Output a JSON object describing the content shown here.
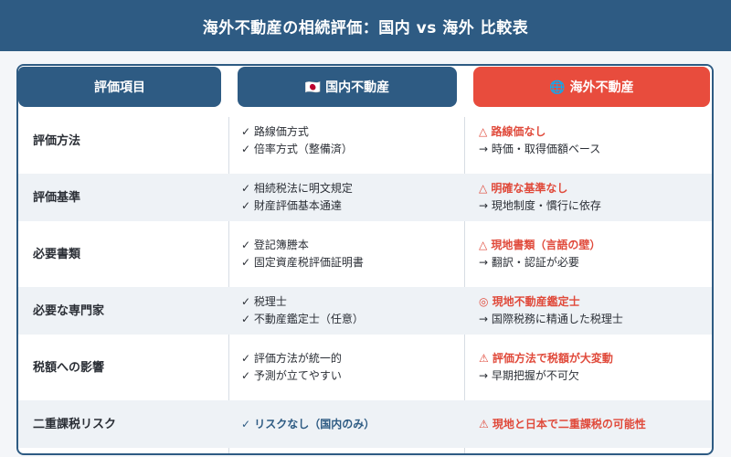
{
  "title": "海外不動産の相続評価：国内 vs 海外 比較表",
  "headers": {
    "item": "評価項目",
    "domestic": "🇯🇵 国内不動産",
    "overseas": "🌐 海外不動産"
  },
  "rows": [
    {
      "label": "評価方法",
      "domestic": [
        "✓ 路線価方式",
        "✓ 倍率方式（整備済）"
      ],
      "overseas_main": "△ 路線価なし",
      "overseas_sub": "→ 時価・取得価額ベース"
    },
    {
      "label": "評価基準",
      "domestic": [
        "✓ 相続税法に明文規定",
        "✓ 財産評価基本通達"
      ],
      "overseas_main": "△ 明確な基準なし",
      "overseas_sub": "→ 現地制度・慣行に依存"
    },
    {
      "label": "必要書類",
      "domestic": [
        "✓ 登記簿謄本",
        "✓ 固定資産税評価証明書"
      ],
      "overseas_main": "△ 現地書類（言語の壁）",
      "overseas_sub": "→ 翻訳・認証が必要"
    },
    {
      "label": "必要な専門家",
      "domestic": [
        "✓ 税理士",
        "✓ 不動産鑑定士（任意）"
      ],
      "overseas_main": "◎ 現地不動産鑑定士",
      "overseas_sub": "→ 国際税務に精通した税理士"
    },
    {
      "label": "税額への影響",
      "domestic": [
        "✓ 評価方法が統一的",
        "✓ 予測が立てやすい"
      ],
      "overseas_main": "⚠ 評価方法で税額が大変動",
      "overseas_sub": "→ 早期把握が不可欠"
    },
    {
      "label": "二重課税リスク",
      "domestic": [
        "✓ リスクなし（国内のみ）"
      ],
      "overseas_main": "⚠ 現地と日本で二重課税の可能性",
      "overseas_sub": ""
    }
  ],
  "colors": {
    "primary": "#2e5b83",
    "accent": "#e84c3d"
  }
}
